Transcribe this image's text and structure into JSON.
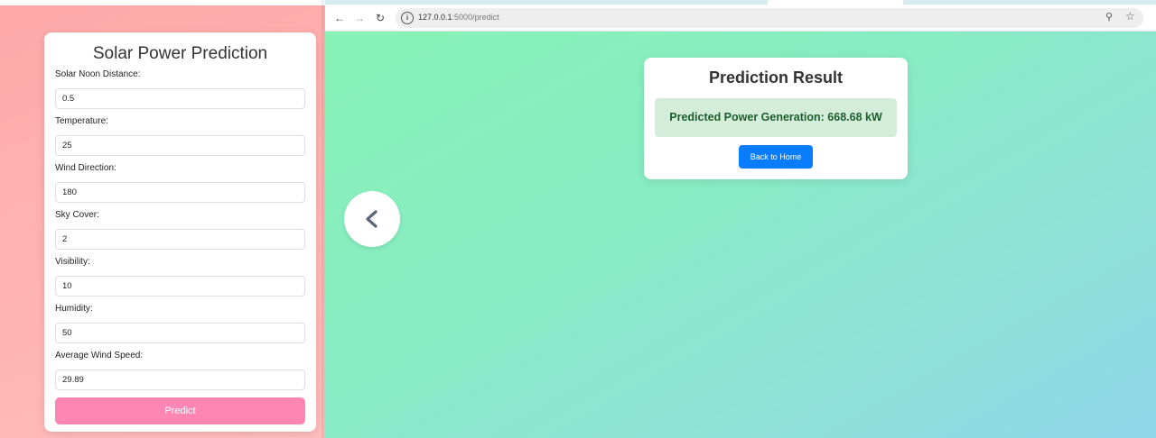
{
  "form": {
    "title": "Solar Power Prediction",
    "fields": [
      {
        "label": "Solar Noon Distance:",
        "value": "0.5"
      },
      {
        "label": "Temperature:",
        "value": "25"
      },
      {
        "label": "Wind Direction:",
        "value": "180"
      },
      {
        "label": "Sky Cover:",
        "value": "2"
      },
      {
        "label": "Visibility:",
        "value": "10"
      },
      {
        "label": "Humidity:",
        "value": "50"
      },
      {
        "label": "Average Wind Speed:",
        "value": "29.89"
      }
    ],
    "submit_label": "Predict"
  },
  "browser": {
    "url_host": "127.0.0.1",
    "url_path": ":5000/predict",
    "back_icon": "arrow-left-icon",
    "forward_icon": "arrow-right-icon",
    "reload_icon": "reload-icon",
    "info_icon": "site-info-icon",
    "zoom_icon": "zoom-icon",
    "bookmark_icon": "star-icon"
  },
  "result": {
    "title": "Prediction Result",
    "message": "Predicted Power Generation: 668.68 kW",
    "back_label": "Back to Home"
  },
  "colors": {
    "form_bg": "#ffaaaa",
    "predict_button": "#ff85b3",
    "result_bg": "#88f0b8",
    "result_box": "#d4eddb",
    "result_text": "#1b5e2b",
    "back_button": "#0a7cff"
  }
}
